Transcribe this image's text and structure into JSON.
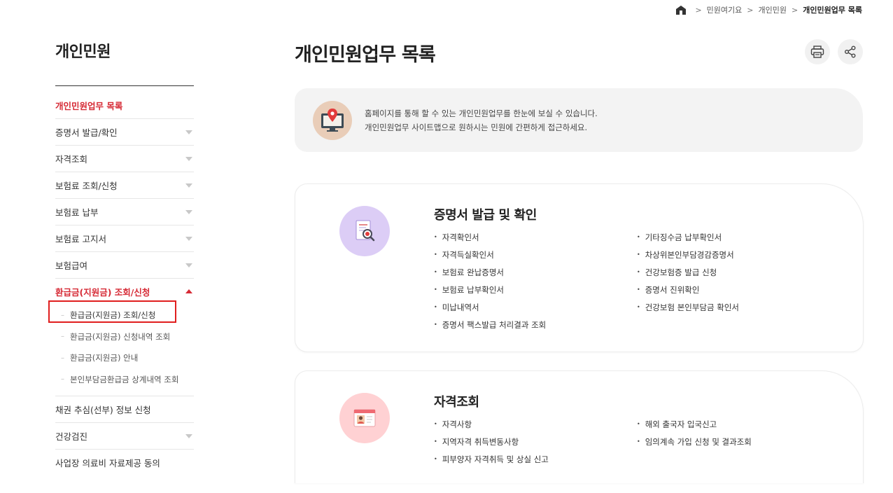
{
  "breadcrumb": {
    "items": [
      "민원여기요",
      "개인민원",
      "개인민원업무 목록"
    ]
  },
  "sidebar": {
    "title": "개인민원",
    "items": [
      {
        "label": "개인민원업무 목록"
      },
      {
        "label": "증명서 발급/확인"
      },
      {
        "label": "자격조회"
      },
      {
        "label": "보험료 조회/신청"
      },
      {
        "label": "보험료 납부"
      },
      {
        "label": "보험료 고지서"
      },
      {
        "label": "보험급여"
      },
      {
        "label": "환급금(지원금) 조회/신청"
      }
    ],
    "sub_items": [
      {
        "label": "환급금(지원금) 조회/신청"
      },
      {
        "label": "환급금(지원금) 신청내역 조회"
      },
      {
        "label": "환급금(지원금) 안내"
      },
      {
        "label": "본인부담금환급금 상계내역 조회"
      }
    ],
    "items_after": [
      {
        "label": "채권 추심(선부) 정보 신청"
      },
      {
        "label": "건강검진"
      },
      {
        "label": "사업장 의료비 자료제공 동의"
      }
    ]
  },
  "main": {
    "title": "개인민원업무 목록",
    "print_icon": "printer-icon",
    "share_icon": "share-icon",
    "intro": {
      "line1": "홈페이지를 통해 할 수 있는 개인민원업무를 한눈에 보실 수 있습니다.",
      "line2": "개인민원업무 사이트맵으로 원하시는 민원에 간편하게 접근하세요."
    },
    "sections": [
      {
        "title": "증명서 발급 및 확인",
        "col1": [
          "자격확인서",
          "자격득실확인서",
          "보험료 완납증명서",
          "보험료 납부확인서",
          "미납내역서",
          "증명서 팩스발급 처리결과 조회"
        ],
        "col2": [
          "기타징수금 납부확인서",
          "차상위본인부담경감증명서",
          "건강보험증 발급 신청",
          "증명서 진위확인",
          "건강보험 본인부담금 확인서"
        ]
      },
      {
        "title": "자격조회",
        "col1": [
          "자격사항",
          "지역자격 취득변동사항",
          "피부양자 자격취득 및 상실 신고"
        ],
        "col2": [
          "해외 출국자 입국신고",
          "임의계속 가입 신청 및 결과조회"
        ]
      }
    ]
  },
  "colors": {
    "accent": "#d62a35",
    "highlight": "#e01e1e"
  }
}
